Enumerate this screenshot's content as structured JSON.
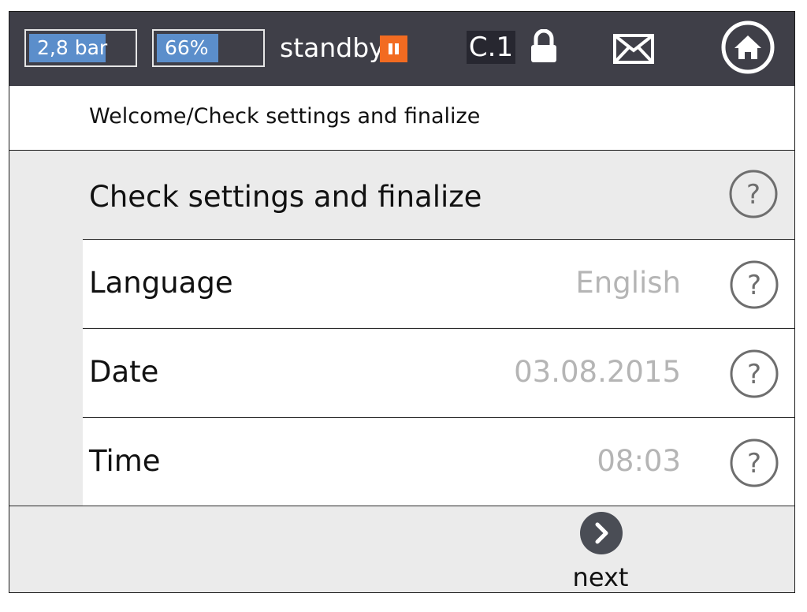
{
  "header": {
    "pressure": {
      "text": "2,8 bar",
      "level_percent": 72
    },
    "level": {
      "text": "66%",
      "level_percent": 58
    },
    "status_text": "standby",
    "code_text": "C.1",
    "icons": [
      "pause-icon",
      "lock-icon",
      "mail-icon",
      "home-icon"
    ],
    "accent_color": "#f26b21",
    "gauge_fill_color": "#5b8ecb"
  },
  "breadcrumb": "Welcome/Check settings and finalize",
  "section_title": "Check settings and finalize",
  "settings": [
    {
      "label": "Language",
      "value": "English"
    },
    {
      "label": "Date",
      "value": "03.08.2015"
    },
    {
      "label": "Time",
      "value": "08:03"
    }
  ],
  "footer": {
    "next_label": "next"
  }
}
